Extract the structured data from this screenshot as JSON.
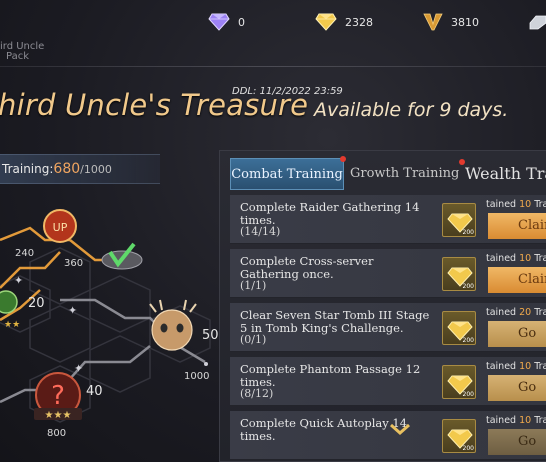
{
  "currencies": [
    {
      "name": "purple-diamond",
      "value": "0",
      "color": "#a78bfa"
    },
    {
      "name": "gold-diamond",
      "value": "2328",
      "color": "#f2c94c"
    },
    {
      "name": "v-token",
      "value": "3810",
      "color": "#e0a03a"
    },
    {
      "name": "silver-ingot",
      "value": "",
      "color": "#cfd3da"
    }
  ],
  "pack": {
    "line1": "ird Uncle",
    "line2": "Pack"
  },
  "headline": {
    "ddl": "DDL: 11/2/2022 23:59",
    "title": "hird Uncle's Treasure",
    "subtitle": "Available for 9 days."
  },
  "training": {
    "label": "Training:",
    "current": "680",
    "max": "/1000"
  },
  "map": {
    "nodes": [
      "240",
      "360",
      "20",
      "50",
      "1000",
      "40",
      "800"
    ]
  },
  "tabs": [
    {
      "label": "Combat Training",
      "active": true,
      "badge": true
    },
    {
      "label": "Growth Training",
      "active": false,
      "badge": true
    },
    {
      "label": "Wealth Tra",
      "active": false,
      "badge": false
    }
  ],
  "tasks": [
    {
      "text": "Complete Raider Gathering 14 times.",
      "progress": "(14/14)",
      "reward_prefix": "tained ",
      "reward_n": "10",
      "reward_suffix": " Trai",
      "icon_qty": "200",
      "button": "Claim"
    },
    {
      "text": "Complete Cross-server Gathering once.",
      "progress": "(1/1)",
      "reward_prefix": "tained ",
      "reward_n": "10",
      "reward_suffix": " Trai",
      "icon_qty": "200",
      "button": "Claim"
    },
    {
      "text": "Clear Seven Star Tomb III Stage 5 in Tomb King's Challenge.",
      "progress": "(0/1)",
      "reward_prefix": "tained ",
      "reward_n": "20",
      "reward_suffix": " Tra",
      "icon_qty": "200",
      "button": "Go"
    },
    {
      "text": "Complete Phantom Passage 12 times.",
      "progress": "(8/12)",
      "reward_prefix": "tained ",
      "reward_n": "10",
      "reward_suffix": " Tra",
      "icon_qty": "200",
      "button": "Go"
    },
    {
      "text": "Complete Quick Autoplay 14 times.",
      "progress": "",
      "reward_prefix": "tained ",
      "reward_n": "10",
      "reward_suffix": " Tra",
      "icon_qty": "200",
      "button": "Go"
    }
  ],
  "colors": {
    "accent_gold": "#f1c98b",
    "tab_active": "#3c6f98",
    "badge_red": "#e33a2e",
    "progress_orange": "#f0a560"
  }
}
